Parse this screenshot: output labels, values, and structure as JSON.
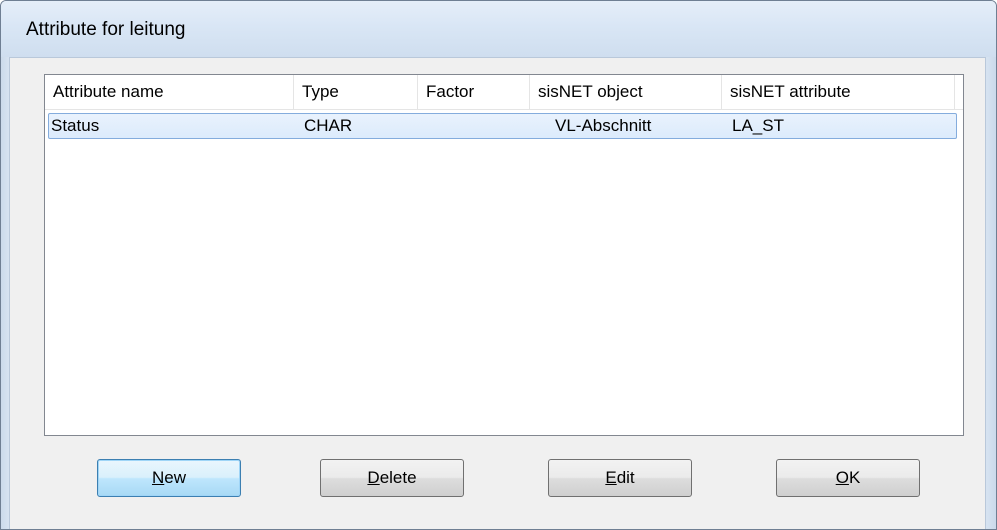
{
  "window": {
    "title": "Attribute for leitung"
  },
  "table": {
    "columns": [
      "Attribute name",
      "Type",
      "Factor",
      "sisNET object",
      "sisNET attribute"
    ],
    "rows": [
      {
        "attribute_name": "Status",
        "type": "CHAR",
        "factor": "",
        "sisnet_object": "VL-Abschnitt",
        "sisnet_attribute": "LA_ST",
        "selected": true
      }
    ]
  },
  "buttons": {
    "new": {
      "mnemonic": "N",
      "rest": "ew"
    },
    "delete": {
      "mnemonic": "D",
      "rest": "elete"
    },
    "edit": {
      "mnemonic": "E",
      "rest": "dit"
    },
    "ok": {
      "mnemonic": "O",
      "rest": "K"
    }
  },
  "colors": {
    "title_bar": "#d9e6f5",
    "selection": "#dcebfc",
    "selection_border": "#84acdd",
    "default_button_border": "#3c7fb1"
  }
}
